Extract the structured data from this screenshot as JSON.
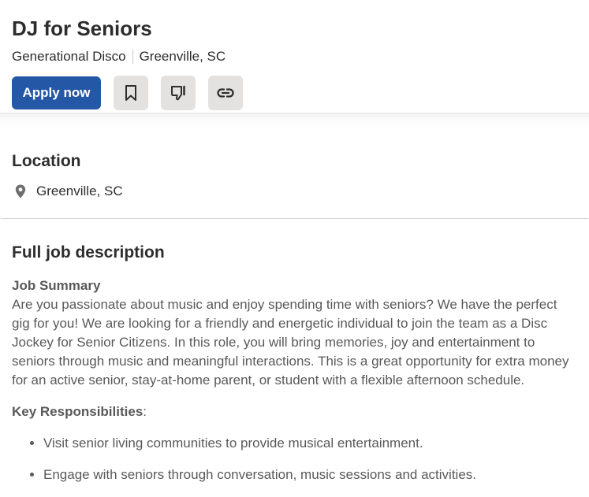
{
  "job": {
    "title": "DJ for Seniors",
    "company": "Generational Disco",
    "location": "Greenville, SC"
  },
  "actions": {
    "apply_label": "Apply now",
    "save_icon": "bookmark-icon",
    "not_interested_icon": "thumbs-down-icon",
    "copy_link_icon": "link-icon"
  },
  "location_section": {
    "heading": "Location",
    "icon": "map-pin-icon",
    "value": "Greenville, SC"
  },
  "description": {
    "heading": "Full job description",
    "summary_heading": "Job Summary",
    "summary_text": "Are you passionate about music and enjoy spending time with seniors? We have the perfect gig for you! We are looking for a friendly and energetic individual to join the team as a Disc Jockey for Senior Citizens. In this role, you will bring memories, joy and entertainment to seniors through music and meaningful interactions. This is a great opportunity for extra money for an active senior, stay-at-home parent, or student with a flexible afternoon schedule.",
    "responsibilities_heading": "Key Responsibilities",
    "responsibilities_colon": ":",
    "responsibilities": [
      "Visit senior living communities to provide musical entertainment.",
      "Engage with seniors through conversation, music sessions and activities."
    ]
  },
  "colors": {
    "primary": "#2557a7",
    "icon_button_bg": "#e4e2e0",
    "text_dark": "#2d2d2d",
    "text_muted": "#595959"
  }
}
